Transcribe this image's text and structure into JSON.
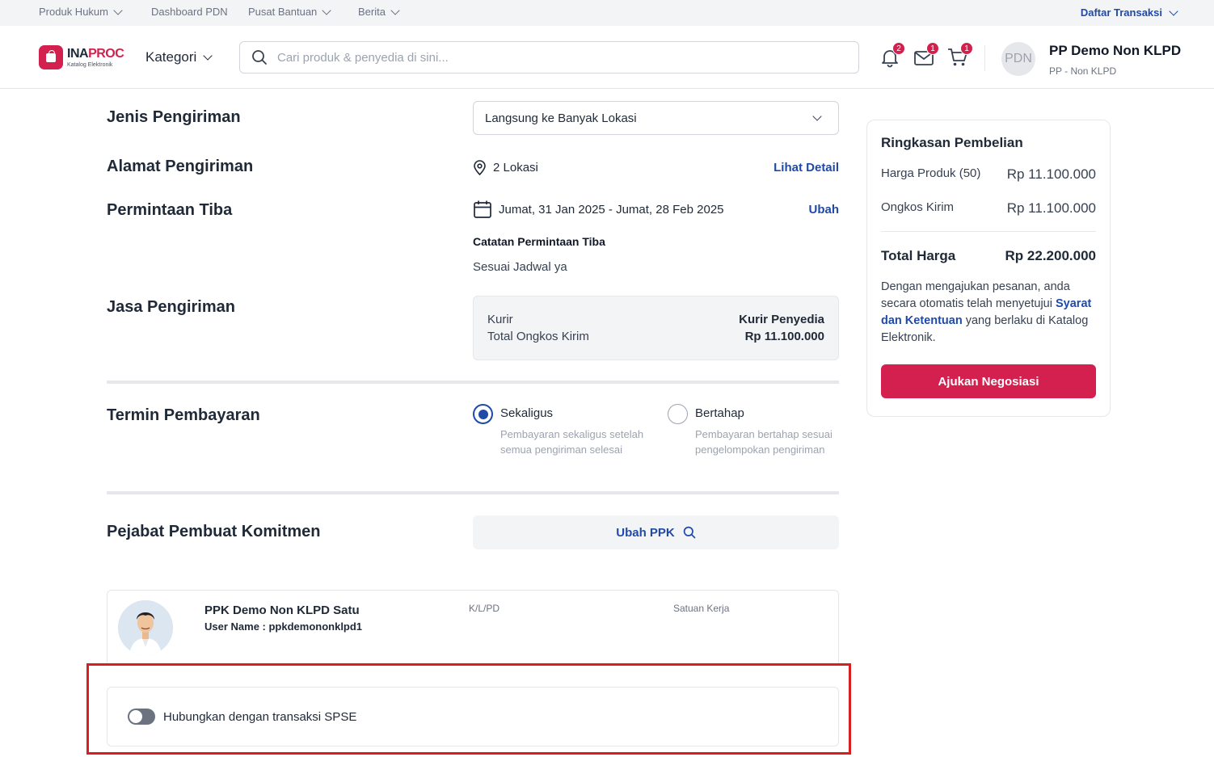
{
  "topbar": {
    "items": [
      "Produk Hukum",
      "Dashboard PDN",
      "Pusat Bantuan",
      "Berita"
    ],
    "right": "Daftar Transaksi"
  },
  "header": {
    "logo_main": "INA",
    "logo_accent": "PROC",
    "logo_sub": "Katalog Elektronik",
    "kategori": "Kategori",
    "search_placeholder": "Cari produk & penyedia di sini...",
    "badges": {
      "notifications": "2",
      "messages": "1",
      "cart": "1"
    },
    "avatar_initials": "PDN",
    "user_name": "PP Demo Non KLPD",
    "user_role": "PP - Non KLPD"
  },
  "shipping": {
    "jenis_title": "Jenis Pengiriman",
    "jenis_value": "Langsung ke Banyak Lokasi",
    "alamat_title": "Alamat Pengiriman",
    "alamat_value": "2 Lokasi",
    "alamat_link": "Lihat Detail",
    "tiba_title": "Permintaan Tiba",
    "tiba_value": "Jumat, 31 Jan 2025 - Jumat, 28 Feb 2025",
    "tiba_link": "Ubah",
    "catatan_title": "Catatan Permintaan Tiba",
    "catatan_value": "Sesuai Jadwal ya",
    "jasa_title": "Jasa Pengiriman",
    "kurir_label": "Kurir",
    "kurir_value": "Kurir Penyedia",
    "ongkir_label": "Total Ongkos Kirim",
    "ongkir_value": "Rp 11.100.000"
  },
  "payment": {
    "title": "Termin Pembayaran",
    "options": [
      {
        "label": "Sekaligus",
        "desc": "Pembayaran sekaligus setelah semua pengiriman selesai",
        "selected": true
      },
      {
        "label": "Bertahap",
        "desc": "Pembayaran bertahap sesuai pengelompokan pengiriman",
        "selected": false
      }
    ]
  },
  "ppk": {
    "title": "Pejabat Pembuat Komitmen",
    "button": "Ubah PPK",
    "name": "PPK Demo Non KLPD Satu",
    "username": "User Name : ppkdemononklpd1",
    "col_klpd": "K/L/PD",
    "col_satker": "Satuan Kerja"
  },
  "spse": {
    "label": "Hubungkan dengan transaksi SPSE",
    "enabled": false
  },
  "summary": {
    "title": "Ringkasan Pembelian",
    "harga_label": "Harga Produk (50)",
    "harga_value": "Rp 11.100.000",
    "ongkir_label": "Ongkos Kirim",
    "ongkir_value": "Rp 11.100.000",
    "total_label": "Total Harga",
    "total_value": "Rp 22.200.000",
    "note_before": "Dengan mengajukan pesanan, anda secara otomatis telah menyetujui ",
    "note_link": "Syarat dan Ketentuan",
    "note_after": " yang berlaku di Katalog Elektronik.",
    "button": "Ajukan Negosiasi"
  },
  "colors": {
    "brand": "#d4204f",
    "link": "#1f4aa8",
    "highlight": "#d81e1e"
  }
}
